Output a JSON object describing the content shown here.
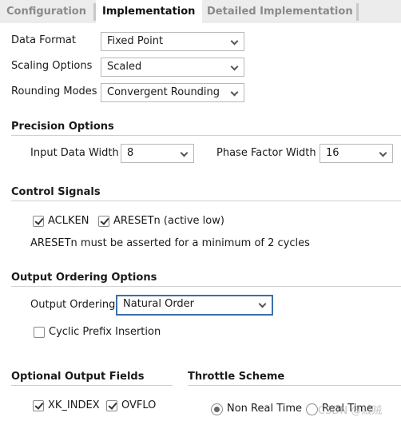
{
  "tabs": [
    "Configuration",
    "Implementation",
    "Detailed Implementation"
  ],
  "active_tab": "Implementation",
  "fields": {
    "data_format": {
      "label": "Data Format",
      "value": "Fixed Point"
    },
    "scaling": {
      "label": "Scaling Options",
      "value": "Scaled"
    },
    "rounding": {
      "label": "Rounding Modes",
      "value": "Convergent Rounding"
    }
  },
  "precision": {
    "title": "Precision Options",
    "input_width_label": "Input Data Width",
    "input_width": "8",
    "phase_width_label": "Phase Factor Width",
    "phase_width": "16"
  },
  "control": {
    "title": "Control Signals",
    "aclken": "ACLKEN",
    "aresetn": "ARESETn (active low)",
    "note": "ARESETn must be asserted for a minimum of 2 cycles"
  },
  "ordering": {
    "title": "Output Ordering Options",
    "label": "Output Ordering",
    "value": "Natural Order",
    "cyclic": "Cyclic Prefix Insertion"
  },
  "optional": {
    "title": "Optional Output Fields",
    "xk_index": "XK_INDEX",
    "ovflo": "OVFLO"
  },
  "throttle": {
    "title": "Throttle Scheme",
    "non_real_time": "Non Real Time",
    "real_time": "Real Time"
  },
  "watermark": "CSDN @贼贼"
}
